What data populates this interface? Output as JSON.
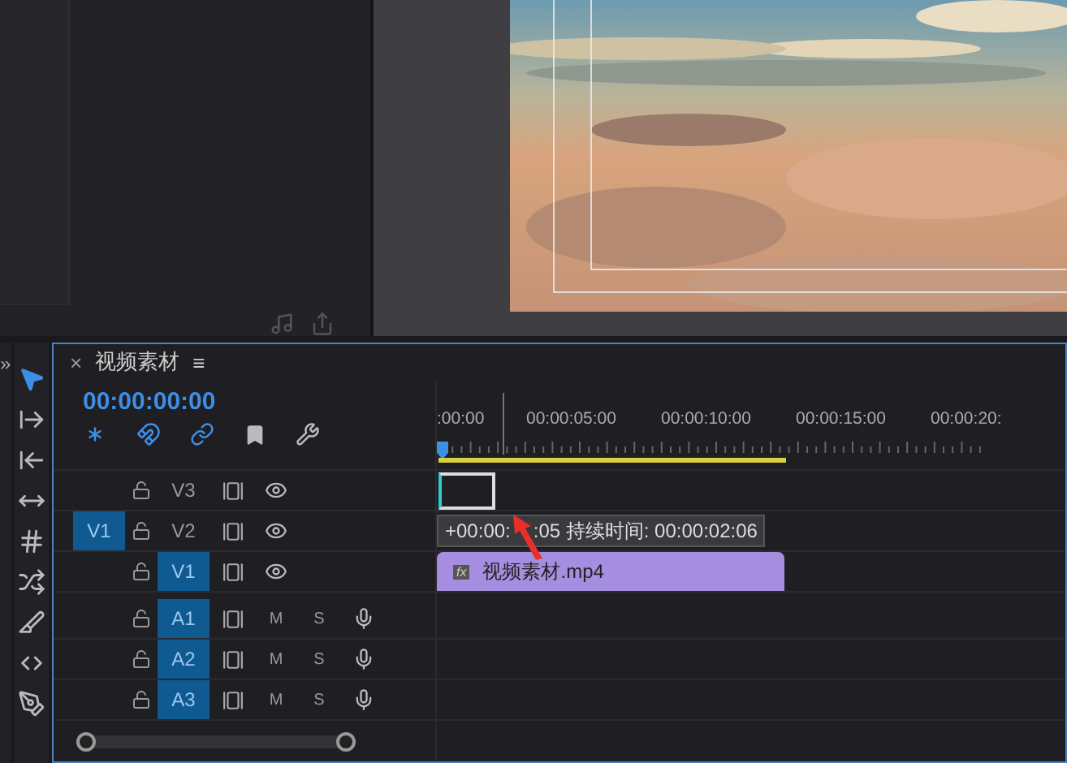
{
  "source_monitor": {
    "buttons": [
      {
        "kind": "audio"
      },
      {
        "kind": "export"
      }
    ]
  },
  "panel_strip": {
    "label": "»"
  },
  "tools": [
    {
      "kind": "selection",
      "selected": true
    },
    {
      "kind": "track-forward",
      "selected": false
    },
    {
      "kind": "ripple",
      "selected": false
    },
    {
      "kind": "rolling",
      "selected": false
    },
    {
      "kind": "rate",
      "selected": false
    },
    {
      "kind": "slip",
      "selected": false
    },
    {
      "kind": "razor",
      "selected": false
    },
    {
      "kind": "slide",
      "selected": false
    },
    {
      "kind": "pen",
      "selected": false
    }
  ],
  "timeline": {
    "close": "×",
    "title": "视频素材",
    "menu": "≡",
    "timecode": "00:00:00:00",
    "ruler_labels": [
      ":00:00",
      "00:00:05:00",
      "00:00:10:00",
      "00:00:15:00",
      "00:00:20:"
    ],
    "tracks": [
      {
        "kind": "video",
        "label": "V3",
        "targeted": false
      },
      {
        "kind": "video",
        "label": "V2",
        "targeted": false,
        "source_patch": "V1"
      },
      {
        "kind": "video",
        "label": "V1",
        "targeted": true
      },
      {
        "kind": "audio",
        "label": "A1",
        "targeted": true,
        "mute": "M",
        "solo": "S"
      },
      {
        "kind": "audio",
        "label": "A2",
        "targeted": true,
        "mute": "M",
        "solo": "S"
      },
      {
        "kind": "audio",
        "label": "A3",
        "targeted": true,
        "mute": "M",
        "solo": "S"
      }
    ],
    "tooltip": {
      "parts": [
        "+00:00:",
        ":05 持续时间: 00:00:02:06"
      ]
    },
    "clip": {
      "badge": "fx",
      "name": "视频素材.mp4"
    }
  }
}
